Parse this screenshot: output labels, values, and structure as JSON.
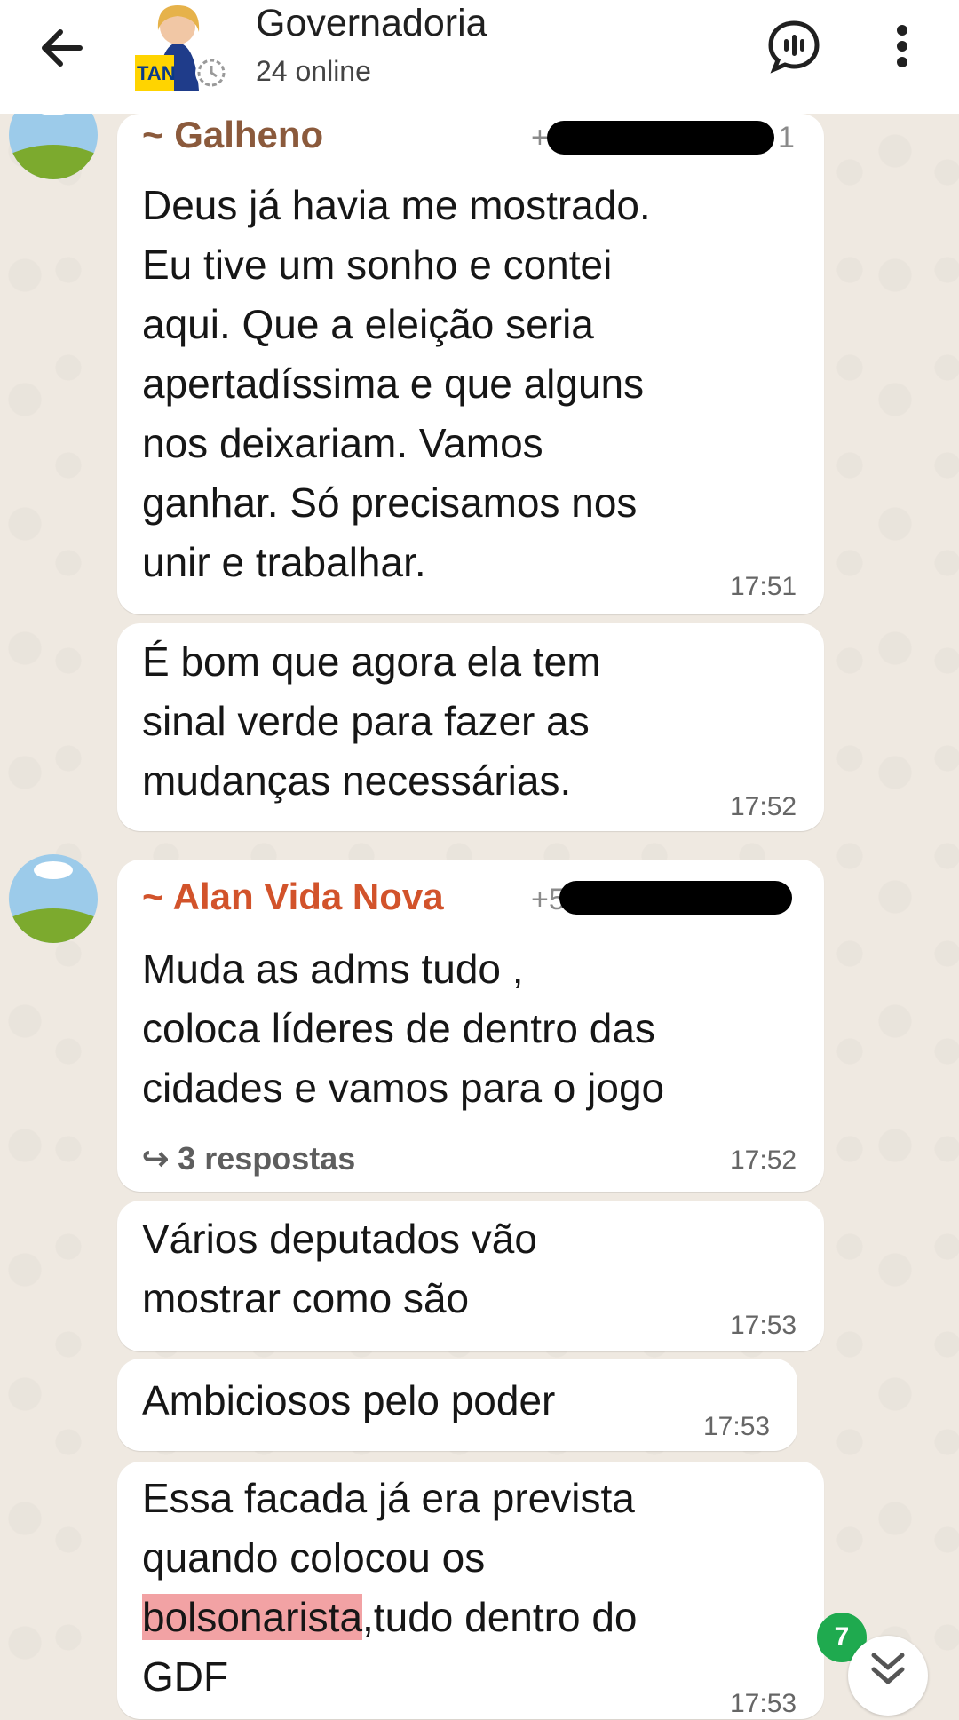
{
  "header": {
    "title": "Governadoria",
    "subtitle": "24 online"
  },
  "messages": [
    {
      "sender": "~ Galheno",
      "sender_color": "#8b5a3c",
      "phone_prefix": "+",
      "phone_suffix": "1",
      "text": "Deus já havia me mostrado.\nEu tive um sonho e contei\naqui. Que a eleição seria\napertadíssima e que alguns\nnos deixariam. Vamos\nganhar. Só precisamos nos\nunir e trabalhar.",
      "time": "17:51"
    },
    {
      "text": "É bom que agora ela tem\nsinal verde para fazer as\nmudanças necessárias.",
      "time": "17:52"
    },
    {
      "sender": "~ Alan Vida Nova",
      "sender_color": "#d2532b",
      "phone_prefix": "+5",
      "text": "Muda as adms tudo ,\ncoloca líderes de dentro das\ncidades e vamos para o jogo",
      "replies": "3 respostas",
      "time": "17:52"
    },
    {
      "text": "Vários deputados vão\nmostrar como são",
      "time": "17:53"
    },
    {
      "text": "Ambiciosos pelo poder",
      "time": "17:53"
    },
    {
      "text_line1": "Essa facada já era prevista",
      "text_line2": "quando colocou os",
      "highlight": "bolsonarista",
      "text_line3_rest": ",tudo dentro do",
      "text_line4": "GDF",
      "time": "17:53"
    }
  ],
  "unread_count": "7",
  "icons": {
    "back": "arrow-left-icon",
    "voice_chat": "voice-chat-icon",
    "menu": "more-vert-icon",
    "scroll_down": "double-chevron-down-icon"
  }
}
